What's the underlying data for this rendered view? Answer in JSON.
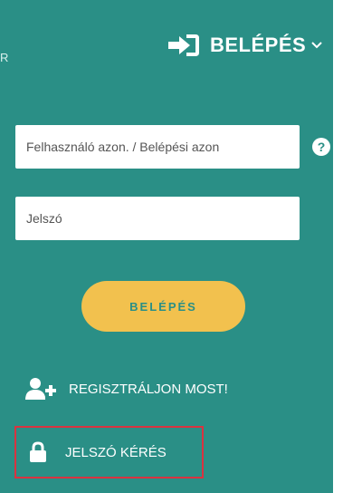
{
  "edge_letter": "R",
  "login_menu": {
    "label": "BELÉPÉS",
    "icon": "sign-in-icon",
    "chevron": "chevron-down-icon"
  },
  "form": {
    "username_placeholder": "Felhasználó azon. / Belépési azon",
    "password_placeholder": "Jelszó",
    "submit_label": "BELÉPÉS",
    "help_icon": "question-circle-icon"
  },
  "links": {
    "register_label": "REGISZTRÁLJON MOST!",
    "register_icon": "user-plus-icon",
    "password_label": "JELSZÓ KÉRÉS",
    "password_icon": "lock-icon"
  },
  "colors": {
    "panel": "#2a8f86",
    "button": "#f2c14e",
    "highlight": "#d93340",
    "text": "#ffffff"
  }
}
